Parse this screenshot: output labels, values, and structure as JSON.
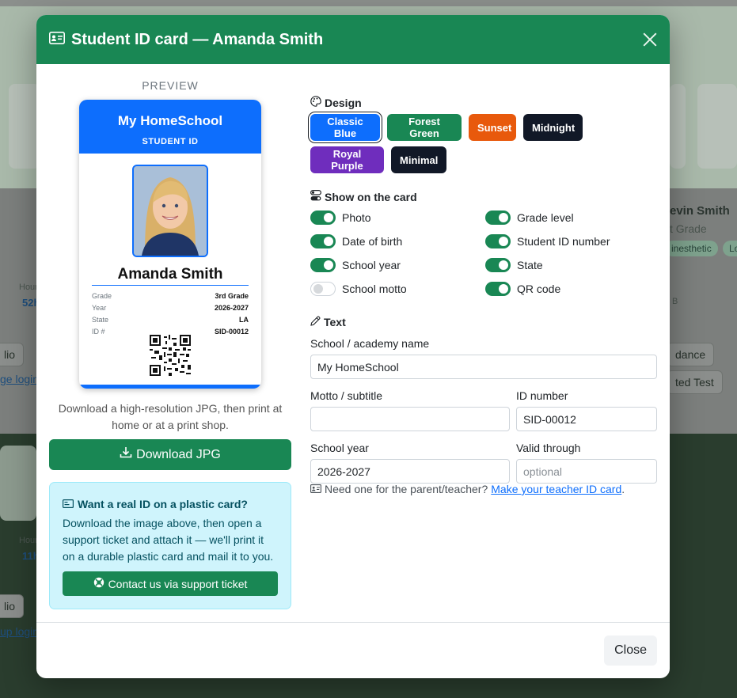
{
  "background": {
    "fragments": {
      "name_partial": "evin Smith",
      "grade_partial": "t Grade",
      "chip1": "inesthetic",
      "chip2": "Lo",
      "hours1": "Hour",
      "hours1_val": "52h",
      "hours2": "Hour",
      "hours2_val": "11h",
      "b_label": "B",
      "lio1": "lio",
      "login1": "ge login",
      "dance": "dance",
      "ated": "ted Test",
      "lio2": "lio",
      "login2": "up login"
    }
  },
  "modal": {
    "title": "Student ID card — Amanda Smith",
    "close_label": "Close"
  },
  "preview": {
    "label": "PREVIEW",
    "card": {
      "school": "My HomeSchool",
      "subtitle": "STUDENT ID",
      "name": "Amanda Smith",
      "rows": [
        {
          "key": "Grade",
          "value": "3rd Grade"
        },
        {
          "key": "Year",
          "value": "2026-2027"
        },
        {
          "key": "State",
          "value": "LA"
        },
        {
          "key": "ID #",
          "value": "SID-00012"
        }
      ],
      "accent": "#0d6efd"
    },
    "download_help": "Download a high-resolution JPG, then print at home or at a print shop.",
    "download_label": "Download JPG"
  },
  "plastic": {
    "title": "Want a real ID on a plastic card?",
    "text": "Download the image above, then open a support ticket and attach it — we'll print it on a durable plastic card and mail it to you.",
    "button_label": "Contact us via support ticket"
  },
  "design": {
    "title": "Design",
    "options": [
      {
        "label": "Classic Blue",
        "color": "#0d6efd",
        "active": true
      },
      {
        "label": "Forest Green",
        "color": "#198754",
        "active": false
      },
      {
        "label": "Sunset",
        "color": "#e8590c",
        "active": false
      },
      {
        "label": "Midnight",
        "color": "#111827",
        "active": false
      },
      {
        "label": "Royal Purple",
        "color": "#6f2dbd",
        "active": false
      },
      {
        "label": "Minimal",
        "color": "#111827",
        "active": false
      }
    ]
  },
  "show": {
    "title": "Show on the card",
    "toggles": [
      {
        "label": "Photo",
        "on": true
      },
      {
        "label": "Grade level",
        "on": true
      },
      {
        "label": "Date of birth",
        "on": true
      },
      {
        "label": "Student ID number",
        "on": true
      },
      {
        "label": "School year",
        "on": true
      },
      {
        "label": "State",
        "on": true
      },
      {
        "label": "School motto",
        "on": false
      },
      {
        "label": "QR code",
        "on": true
      }
    ]
  },
  "text": {
    "title": "Text",
    "school_label": "School / academy name",
    "school_value": "My HomeSchool",
    "motto_label": "Motto / subtitle",
    "motto_value": "",
    "id_label": "ID number",
    "id_value": "SID-00012",
    "year_label": "School year",
    "year_value": "2026-2027",
    "valid_label": "Valid through",
    "valid_placeholder": "optional"
  },
  "teacher": {
    "prefix": "Need one for the parent/teacher?",
    "link": "Make your teacher ID card",
    "suffix": "."
  }
}
